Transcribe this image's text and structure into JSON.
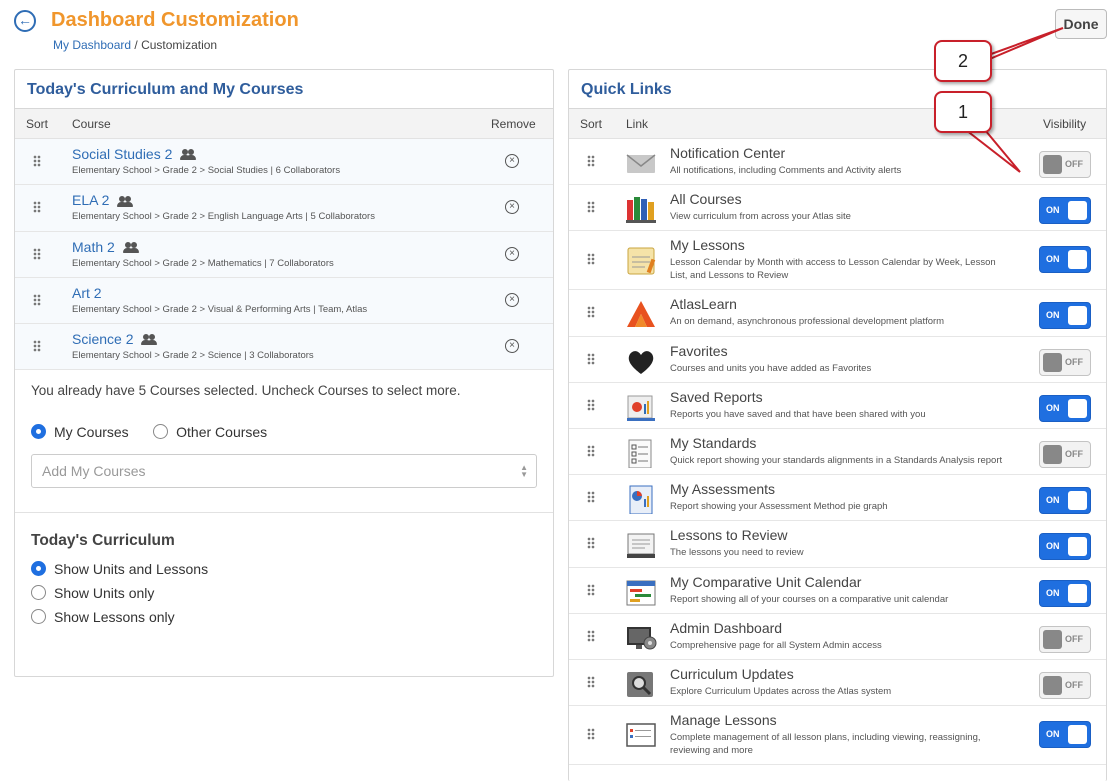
{
  "header": {
    "title": "Dashboard Customization",
    "breadcrumb_home": "My Dashboard",
    "breadcrumb_sep": "/",
    "breadcrumb_current": "Customization",
    "done_label": "Done"
  },
  "left_panel": {
    "title": "Today's Curriculum and My Courses",
    "col_sort": "Sort",
    "col_course": "Course",
    "col_remove": "Remove",
    "courses": [
      {
        "name": "Social Studies 2",
        "details": "Elementary School > Grade 2 > Social Studies | 6 Collaborators",
        "collab": true
      },
      {
        "name": "ELA 2",
        "details": "Elementary School > Grade 2 > English Language Arts | 5 Collaborators",
        "collab": true
      },
      {
        "name": "Math 2",
        "details": "Elementary School > Grade 2 > Mathematics | 7 Collaborators",
        "collab": true
      },
      {
        "name": "Art 2",
        "details": "Elementary School > Grade 2 > Visual & Performing Arts | Team, Atlas",
        "collab": false
      },
      {
        "name": "Science 2",
        "details": "Elementary School > Grade 2 > Science | 3 Collaborators",
        "collab": true
      }
    ],
    "note": "You already have 5 Courses selected. Uncheck Courses to select more.",
    "radio_my_courses": "My Courses",
    "radio_other_courses": "Other Courses",
    "select_placeholder": "Add My Courses",
    "curriculum_title": "Today's Curriculum",
    "curriculum_options": [
      {
        "label": "Show Units and Lessons",
        "checked": true
      },
      {
        "label": "Show Units only",
        "checked": false
      },
      {
        "label": "Show Lessons only",
        "checked": false
      }
    ]
  },
  "right_panel": {
    "title": "Quick Links",
    "col_sort": "Sort",
    "col_link": "Link",
    "col_visibility": "Visibility",
    "on_label": "ON",
    "off_label": "OFF",
    "links": [
      {
        "title": "Notification Center",
        "desc": "All notifications, including Comments and Activity alerts",
        "on": false,
        "icon": "envelope-icon"
      },
      {
        "title": "All Courses",
        "desc": "View curriculum from across your Atlas site",
        "on": true,
        "icon": "books-icon"
      },
      {
        "title": "My Lessons",
        "desc": "Lesson Calendar by Month with access to Lesson Calendar by Week, Lesson List, and Lessons to Review",
        "on": true,
        "icon": "lesson-planning-icon"
      },
      {
        "title": "AtlasLearn",
        "desc": "An on demand, asynchronous professional development platform",
        "on": true,
        "icon": "atlaslearn-logo-icon"
      },
      {
        "title": "Favorites",
        "desc": "Courses and units you have added as Favorites",
        "on": false,
        "icon": "heart-icon"
      },
      {
        "title": "Saved Reports",
        "desc": "Reports you have saved and that have been shared with you",
        "on": true,
        "icon": "report-icon"
      },
      {
        "title": "My Standards",
        "desc": "Quick report showing your standards alignments in a Standards Analysis report",
        "on": false,
        "icon": "checklist-icon"
      },
      {
        "title": "My Assessments",
        "desc": "Report showing your Assessment Method pie graph",
        "on": true,
        "icon": "pie-report-icon"
      },
      {
        "title": "Lessons to Review",
        "desc": "The lessons you need to review",
        "on": true,
        "icon": "review-icon"
      },
      {
        "title": "My Comparative Unit Calendar",
        "desc": "Report showing all of your courses on a comparative unit calendar",
        "on": true,
        "icon": "calendar-icon"
      },
      {
        "title": "Admin Dashboard",
        "desc": "Comprehensive page for all System Admin access",
        "on": false,
        "icon": "admin-monitor-icon"
      },
      {
        "title": "Curriculum Updates",
        "desc": "Explore Curriculum Updates across the Atlas system",
        "on": false,
        "icon": "magnifier-icon"
      },
      {
        "title": "Manage Lessons",
        "desc": "Complete management of all lesson plans, including viewing, reassigning, reviewing and more",
        "on": true,
        "icon": "manage-lessons-icon"
      }
    ]
  },
  "callouts": {
    "one": "1",
    "two": "2"
  },
  "colors": {
    "title_orange": "#f0962c",
    "link_blue": "#2f6db5",
    "toggle_on": "#1f6fe0",
    "callout_red": "#c8202a"
  }
}
